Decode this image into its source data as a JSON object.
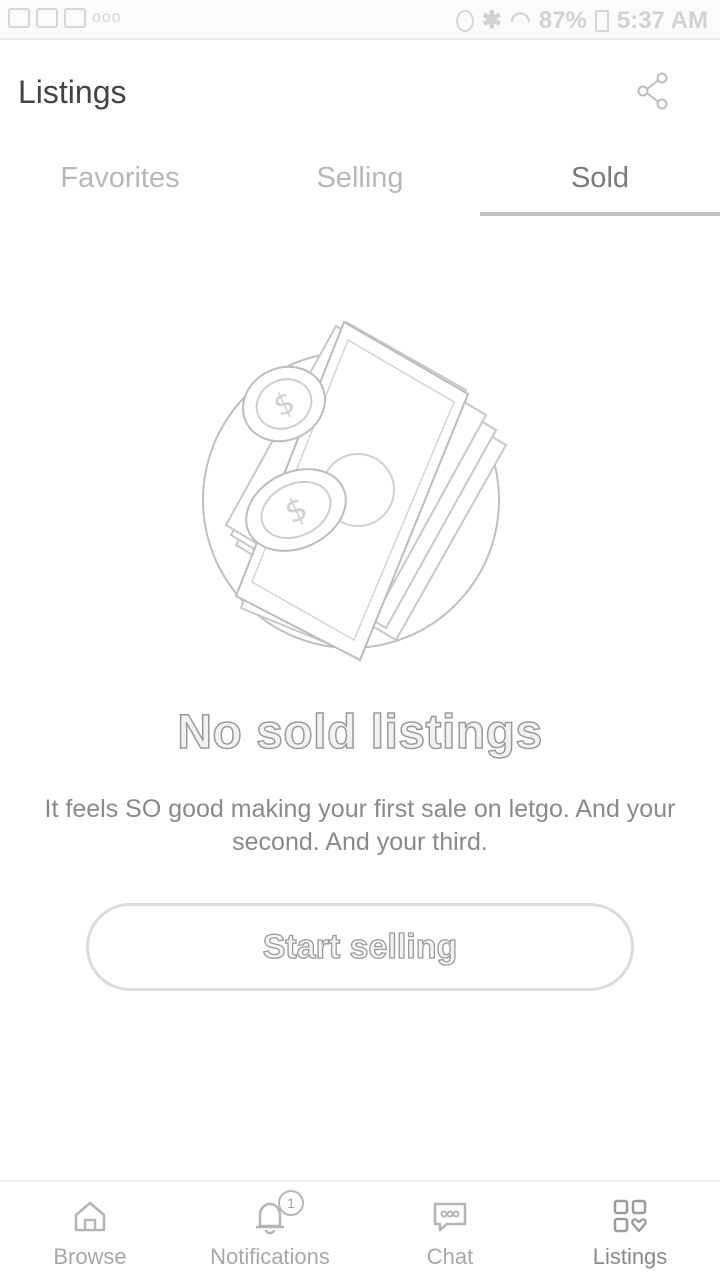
{
  "status_bar": {
    "battery": "87%",
    "time": "5:37 AM"
  },
  "header": {
    "title": "Listings"
  },
  "tabs": [
    {
      "label": "Favorites",
      "active": false
    },
    {
      "label": "Selling",
      "active": false
    },
    {
      "label": "Sold",
      "active": true
    }
  ],
  "empty_state": {
    "title": "No sold listings",
    "description": "It feels SO good making your first sale on letgo. And your second. And your third.",
    "button_label": "Start selling"
  },
  "bottom_nav": {
    "items": [
      {
        "label": "Browse",
        "icon": "home-icon"
      },
      {
        "label": "Notifications",
        "icon": "bell-icon",
        "badge": "1"
      },
      {
        "label": "Chat",
        "icon": "chat-icon"
      },
      {
        "label": "Listings",
        "icon": "grid-heart-icon",
        "active": true
      }
    ]
  }
}
